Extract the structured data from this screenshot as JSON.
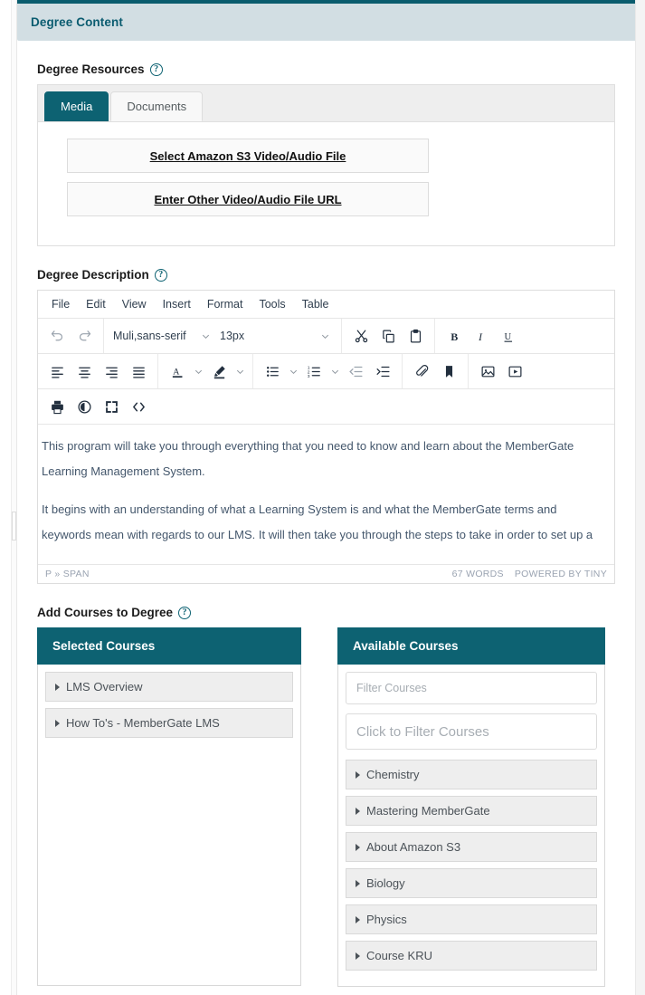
{
  "panel": {
    "title": "Degree Content"
  },
  "sections": {
    "resources_label": "Degree Resources",
    "description_label": "Degree Description",
    "courses_label": "Add Courses to Degree",
    "help_glyph": "?"
  },
  "resources": {
    "tabs": [
      {
        "label": "Media",
        "active": true
      },
      {
        "label": "Documents",
        "active": false
      }
    ],
    "buttons": [
      "Select Amazon S3 Video/Audio File",
      "Enter Other Video/Audio File URL"
    ]
  },
  "editor": {
    "menu": [
      "File",
      "Edit",
      "View",
      "Insert",
      "Format",
      "Tools",
      "Table"
    ],
    "font_family_value": "Muli,sans-serif",
    "font_size_value": "13px",
    "toolbar_row1_icons": [
      "undo-icon",
      "redo-icon",
      "cut-icon",
      "copy-icon",
      "paste-icon",
      "bold-icon",
      "italic-icon",
      "underline-icon"
    ],
    "toolbar_row2_icons": [
      "align-left-icon",
      "align-center-icon",
      "align-right-icon",
      "align-justify-icon",
      "text-color-icon",
      "highlight-color-icon",
      "bullet-list-icon",
      "numbered-list-icon",
      "outdent-icon",
      "indent-icon",
      "link-icon",
      "bookmark-icon",
      "image-icon",
      "media-icon"
    ],
    "toolbar_row3_icons": [
      "print-icon",
      "preview-icon",
      "fullscreen-icon",
      "source-code-icon"
    ],
    "content": [
      "This program will take you through everything that you need to know and learn about the MemberGate Learning Management System.",
      "It begins with an understanding of what a Learning System is and what the MemberGate terms and keywords mean with regards to our LMS. It will then take you through the steps to take in order to set up a"
    ],
    "content_lines": [
      "This program will take you through everything that you need to know and learn about the MemberGate",
      "Learning Management System.",
      "It begins with an understanding of what a Learning System is and what the MemberGate terms and",
      "keywords mean with regards to our LMS. It will then take you through the steps to take in order to set up a"
    ],
    "status_path": "P » SPAN",
    "status_words": "67 WORDS",
    "status_branding": "POWERED BY TINY"
  },
  "selected_courses": {
    "header": "Selected Courses",
    "items": [
      "LMS Overview",
      "How To's - MemberGate LMS"
    ]
  },
  "available_courses": {
    "header": "Available Courses",
    "filter_placeholder": "Filter Courses",
    "filter_click_placeholder": "Click to Filter Courses",
    "items": [
      "Chemistry",
      "Mastering MemberGate",
      "About Amazon S3",
      "Biology",
      "Physics",
      "Course KRU"
    ]
  },
  "colors": {
    "teal": "#0d6272",
    "teal_dark": "#0a5c6e",
    "header_bg": "#d2dee3",
    "item_bg": "#eeeeee"
  }
}
